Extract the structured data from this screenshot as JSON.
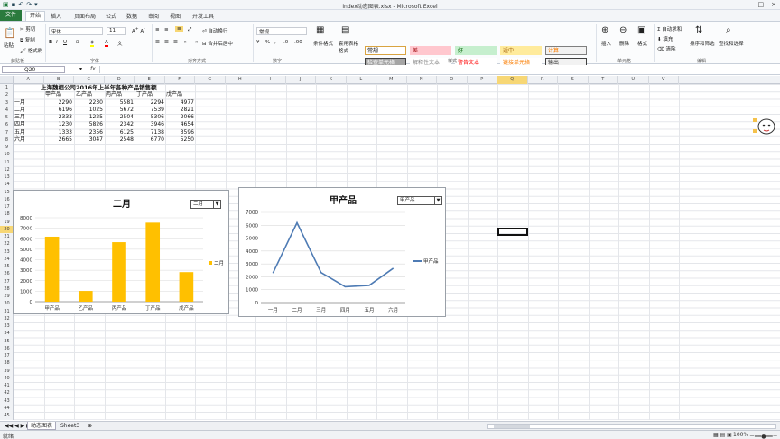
{
  "window": {
    "title": "index动态图表.xlsx - Microsoft Excel"
  },
  "ribbon_tabs": [
    "文件",
    "开始",
    "插入",
    "页面布局",
    "公式",
    "数据",
    "审阅",
    "视图",
    "开发工具"
  ],
  "ribbon": {
    "clipboard": {
      "paste": "粘贴",
      "cut": "剪切",
      "copy": "复制",
      "format_painter": "格式刷",
      "label": "剪贴板"
    },
    "font": {
      "name": "宋体",
      "size": "11",
      "label": "字体"
    },
    "alignment": {
      "wrap": "自动换行",
      "merge": "合并后居中",
      "label": "对齐方式"
    },
    "number": {
      "format": "常规",
      "percent": "%",
      "label": "数字"
    },
    "styles": {
      "conditional": "条件格式",
      "table": "套用表格格式",
      "boxes": [
        {
          "text": "常规",
          "bg": "#ffffff",
          "fg": "#000000",
          "border": "#d9a441"
        },
        {
          "text": "差",
          "bg": "#ffc7ce",
          "fg": "#9c0006",
          "border": "#ffc7ce"
        },
        {
          "text": "好",
          "bg": "#c6efce",
          "fg": "#006100",
          "border": "#c6efce"
        },
        {
          "text": "适中",
          "bg": "#ffeb9c",
          "fg": "#9c5700",
          "border": "#ffeb9c"
        },
        {
          "text": "计算",
          "bg": "#f2f2f2",
          "fg": "#fa7d00",
          "border": "#7f7f7f"
        },
        {
          "text": "检查单元格",
          "bg": "#a5a5a5",
          "fg": "#ffffff",
          "border": "#3f3f3f"
        },
        {
          "text": "解释性文本",
          "bg": "#ffffff",
          "fg": "#7f7f7f",
          "border": "#ffffff"
        },
        {
          "text": "警告文本",
          "bg": "#ffffff",
          "fg": "#ff0000",
          "border": "#ffffff"
        },
        {
          "text": "链接单元格",
          "bg": "#ffffff",
          "fg": "#fa7d00",
          "border": "#ffffff"
        },
        {
          "text": "输出",
          "bg": "#f2f2f2",
          "fg": "#3f3f3f",
          "border": "#3f3f3f"
        }
      ],
      "label": "样式"
    },
    "cells": {
      "insert": "插入",
      "delete": "删除",
      "format": "格式",
      "label": "单元格"
    },
    "editing": {
      "autosum": "自动求和",
      "fill": "填充",
      "clear": "清除",
      "sort": "排序和筛选",
      "find": "查找和选择",
      "label": "编辑"
    }
  },
  "formula_bar": {
    "name_box": "Q20",
    "fx": "fx",
    "value": ""
  },
  "columns": [
    "A",
    "B",
    "C",
    "D",
    "E",
    "F",
    "G",
    "H",
    "I",
    "J",
    "K",
    "L",
    "M",
    "N",
    "O",
    "P",
    "Q",
    "R",
    "S",
    "T",
    "U",
    "V"
  ],
  "selected_column": "Q",
  "selected_row": 20,
  "sheet": {
    "title": "上海魏桓公司2016年上半年各种产品销售额",
    "headers": [
      "甲产品",
      "乙产品",
      "丙产品",
      "丁产品",
      "戊产品"
    ],
    "rows": [
      {
        "month": "一月",
        "values": [
          2290,
          2230,
          5581,
          2294,
          4977
        ]
      },
      {
        "month": "二月",
        "values": [
          6196,
          1025,
          5672,
          7539,
          2821
        ]
      },
      {
        "month": "三月",
        "values": [
          2333,
          1225,
          2504,
          5306,
          2066
        ]
      },
      {
        "month": "四月",
        "values": [
          1230,
          5826,
          2342,
          3946,
          4654
        ]
      },
      {
        "month": "五月",
        "values": [
          1333,
          2356,
          6125,
          7138,
          3596
        ]
      },
      {
        "month": "六月",
        "values": [
          2665,
          3047,
          2548,
          6770,
          5250
        ]
      }
    ]
  },
  "chart_data": [
    {
      "type": "bar",
      "title": "二月",
      "dropdown": "二月",
      "categories": [
        "甲产品",
        "乙产品",
        "丙产品",
        "丁产品",
        "戊产品"
      ],
      "series": [
        {
          "name": "二月",
          "values": [
            6196,
            1025,
            5672,
            7539,
            2821
          ]
        }
      ],
      "ylim": [
        0,
        8000
      ],
      "yticks": [
        0,
        1000,
        2000,
        3000,
        4000,
        5000,
        6000,
        7000,
        8000
      ],
      "grid": true,
      "legend": "right",
      "color": "#ffc000"
    },
    {
      "type": "line",
      "title": "甲产品",
      "dropdown": "甲产品",
      "categories": [
        "一月",
        "二月",
        "三月",
        "四月",
        "五月",
        "六月"
      ],
      "series": [
        {
          "name": "甲产品",
          "values": [
            2290,
            6196,
            2333,
            1230,
            1333,
            2665
          ]
        }
      ],
      "ylim": [
        0,
        7000
      ],
      "yticks": [
        0,
        1000,
        2000,
        3000,
        4000,
        5000,
        6000,
        7000
      ],
      "grid": true,
      "legend": "right",
      "color": "#4e7bb4"
    }
  ],
  "sheet_tabs": [
    "动态图表",
    "Sheet3"
  ],
  "status": {
    "ready": "就绪",
    "zoom": "100%"
  }
}
